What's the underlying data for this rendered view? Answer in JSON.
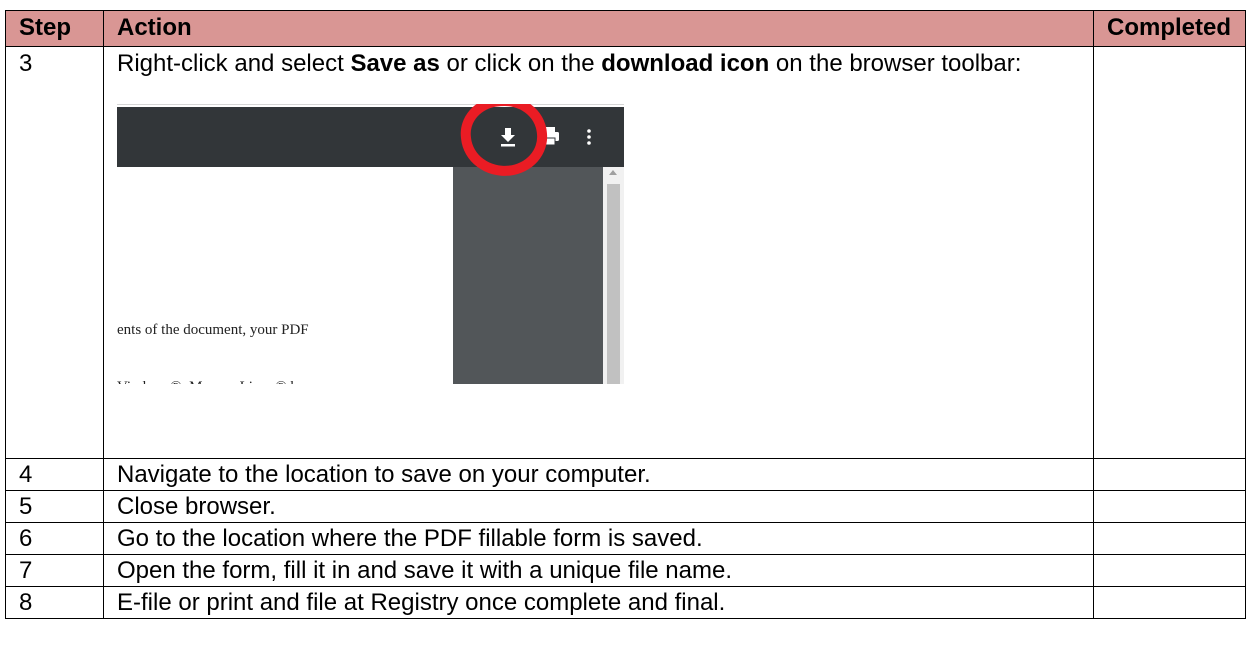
{
  "table": {
    "headers": {
      "step": "Step",
      "action": "Action",
      "completed": "Completed"
    },
    "rows": [
      {
        "step": "3",
        "action_parts": [
          "Right-click and select ",
          "Save as",
          " or click on the ",
          "download icon",
          " on the browser toolbar:"
        ],
        "completed": ""
      },
      {
        "step": "4",
        "action": "Navigate to the location to save on your computer.",
        "completed": ""
      },
      {
        "step": "5",
        "action": "Close browser.",
        "completed": ""
      },
      {
        "step": "6",
        "action": "Go to the location where the PDF fillable form is saved.",
        "completed": ""
      },
      {
        "step": "7",
        "action": "Open the form, fill it in and save it with a unique file name.",
        "completed": ""
      },
      {
        "step": "8",
        "action": "E-file or print and file at Registry once complete and final.",
        "completed": ""
      }
    ]
  },
  "figure": {
    "icons": [
      "download-icon",
      "print-icon",
      "more-vertical-icon"
    ],
    "text_fragments": [
      "ents of the document, your PDF",
      "Vindows®, Mac, or Linux® by"
    ],
    "colors": {
      "toolbar": "#323639",
      "sidebar": "#525659",
      "highlight_circle": "#ea1c24",
      "header_fill": "#d99694"
    }
  }
}
